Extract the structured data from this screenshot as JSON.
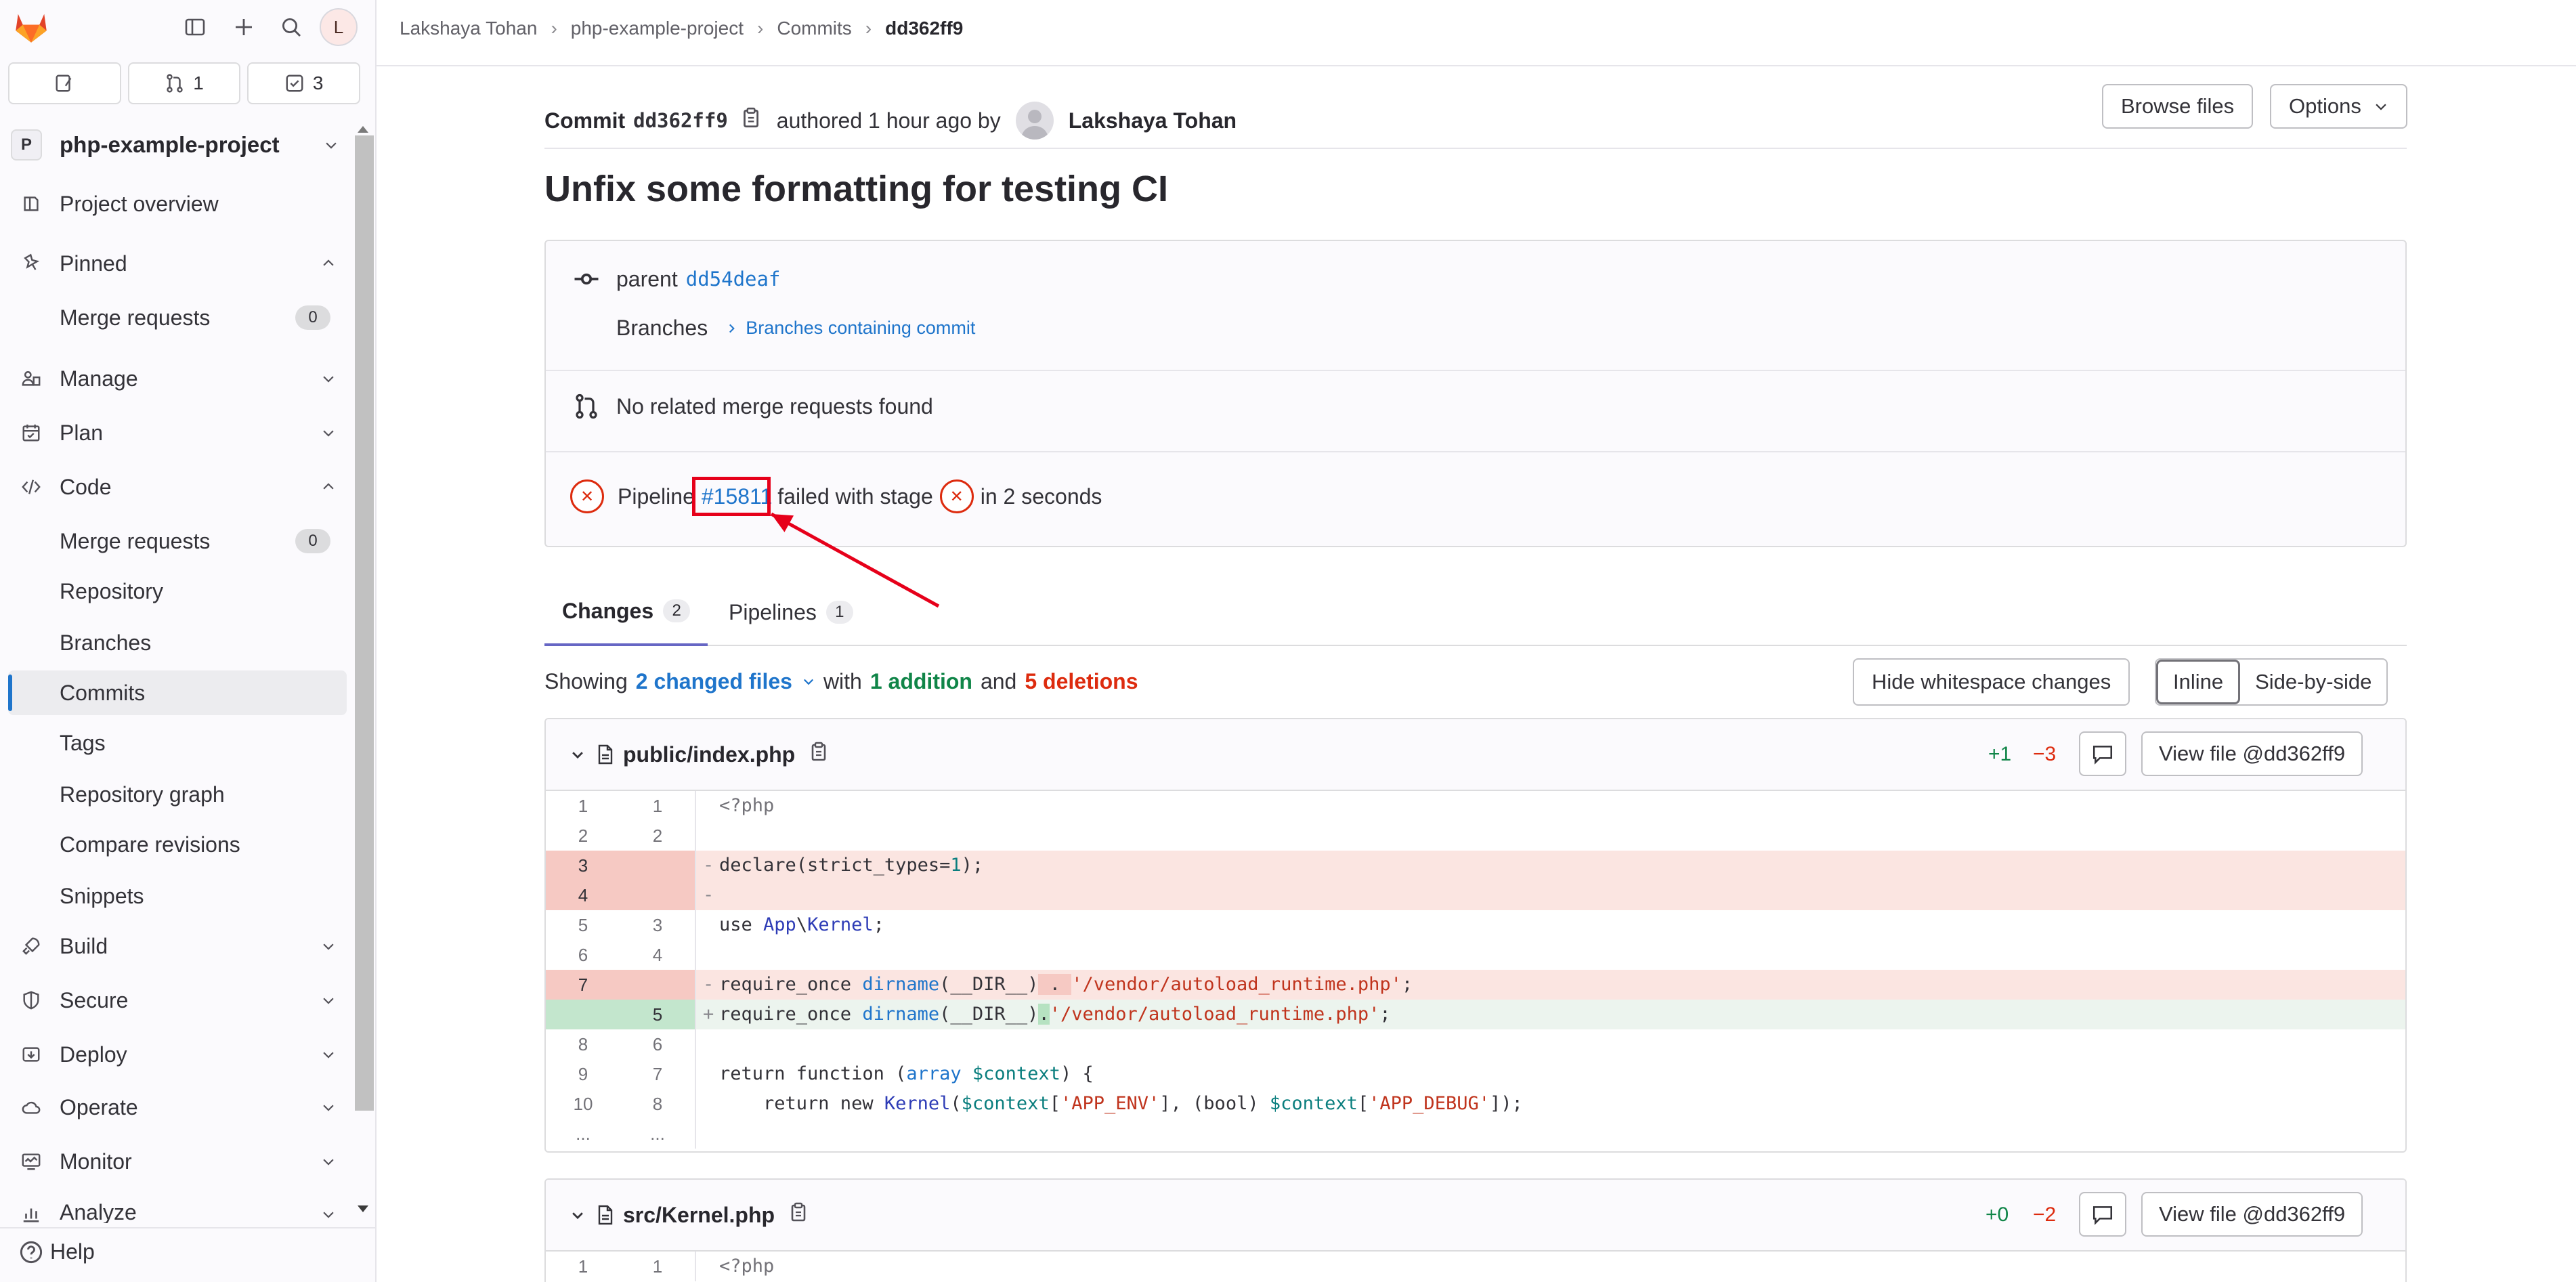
{
  "sidebar": {
    "counters": {
      "merge_requests": "1",
      "todos": "3"
    },
    "project": {
      "initial": "P",
      "name": "php-example-project"
    },
    "items": [
      {
        "label": "Project overview"
      },
      {
        "label": "Pinned"
      },
      {
        "label": "Merge requests",
        "count": "0"
      },
      {
        "label": "Manage"
      },
      {
        "label": "Plan"
      },
      {
        "label": "Code"
      },
      {
        "label": "Merge requests",
        "count": "0"
      },
      {
        "label": "Repository"
      },
      {
        "label": "Branches"
      },
      {
        "label": "Commits"
      },
      {
        "label": "Tags"
      },
      {
        "label": "Repository graph"
      },
      {
        "label": "Compare revisions"
      },
      {
        "label": "Snippets"
      },
      {
        "label": "Build"
      },
      {
        "label": "Secure"
      },
      {
        "label": "Deploy"
      },
      {
        "label": "Operate"
      },
      {
        "label": "Monitor"
      },
      {
        "label": "Analyze"
      }
    ],
    "avatar_initial": "L",
    "help_label": "Help"
  },
  "breadcrumbs": [
    "Lakshaya Tohan",
    "php-example-project",
    "Commits",
    "dd362ff9"
  ],
  "commit": {
    "label": "Commit",
    "sha": "dd362ff9",
    "authored_text": "authored 1 hour ago by",
    "author": "Lakshaya Tohan",
    "browse_files": "Browse files",
    "options": "Options",
    "title": "Unfix some formatting for testing CI",
    "parent_label": "parent",
    "parent_sha": "dd54deaf",
    "branches_label": "Branches",
    "branches_link": "Branches containing commit",
    "mr_text": "No related merge requests found",
    "pipeline_label": "Pipeline",
    "pipeline_id": "#15811",
    "pipeline_text": "failed with stage",
    "pipeline_duration": "in 2 seconds"
  },
  "tabs": [
    {
      "label": "Changes",
      "count": "2"
    },
    {
      "label": "Pipelines",
      "count": "1"
    }
  ],
  "summary": {
    "showing": "Showing",
    "files_link": "2 changed files",
    "with": "with",
    "additions": "1 addition",
    "and": "and",
    "deletions": "5 deletions",
    "hide_whitespace": "Hide whitespace changes",
    "inline": "Inline",
    "side_by_side": "Side-by-side"
  },
  "files": [
    {
      "path": "public/index.php",
      "added": "+1",
      "removed": "−3",
      "view_file": "View file @dd362ff9",
      "lines": [
        {
          "old": "1",
          "new": "1",
          "type": "ctx",
          "text": "<?php"
        },
        {
          "old": "2",
          "new": "2",
          "type": "ctx",
          "text": ""
        },
        {
          "old": "3",
          "new": "",
          "type": "del",
          "text": "declare(strict_types=1);"
        },
        {
          "old": "4",
          "new": "",
          "type": "del",
          "text": ""
        },
        {
          "old": "5",
          "new": "3",
          "type": "ctx",
          "text": "use App\\Kernel;"
        },
        {
          "old": "6",
          "new": "4",
          "type": "ctx",
          "text": ""
        },
        {
          "old": "7",
          "new": "",
          "type": "del",
          "text": "require_once dirname(__DIR__) . '/vendor/autoload_runtime.php';"
        },
        {
          "old": "",
          "new": "5",
          "type": "add",
          "text": "require_once dirname(__DIR__).'/vendor/autoload_runtime.php';"
        },
        {
          "old": "8",
          "new": "6",
          "type": "ctx",
          "text": ""
        },
        {
          "old": "9",
          "new": "7",
          "type": "ctx",
          "text": "return function (array $context) {"
        },
        {
          "old": "10",
          "new": "8",
          "type": "ctx",
          "text": "    return new Kernel($context['APP_ENV'], (bool) $context['APP_DEBUG']);"
        },
        {
          "old": "...",
          "new": "...",
          "type": "ctx",
          "text": ""
        }
      ]
    },
    {
      "path": "src/Kernel.php",
      "added": "+0",
      "removed": "−2",
      "view_file": "View file @dd362ff9",
      "lines": [
        {
          "old": "1",
          "new": "1",
          "type": "ctx",
          "text": "<?php"
        }
      ]
    }
  ],
  "colors": {
    "accent": "#1f75cb",
    "danger": "#dd2b0e",
    "success": "#108548",
    "annotation": "#e6001a"
  }
}
